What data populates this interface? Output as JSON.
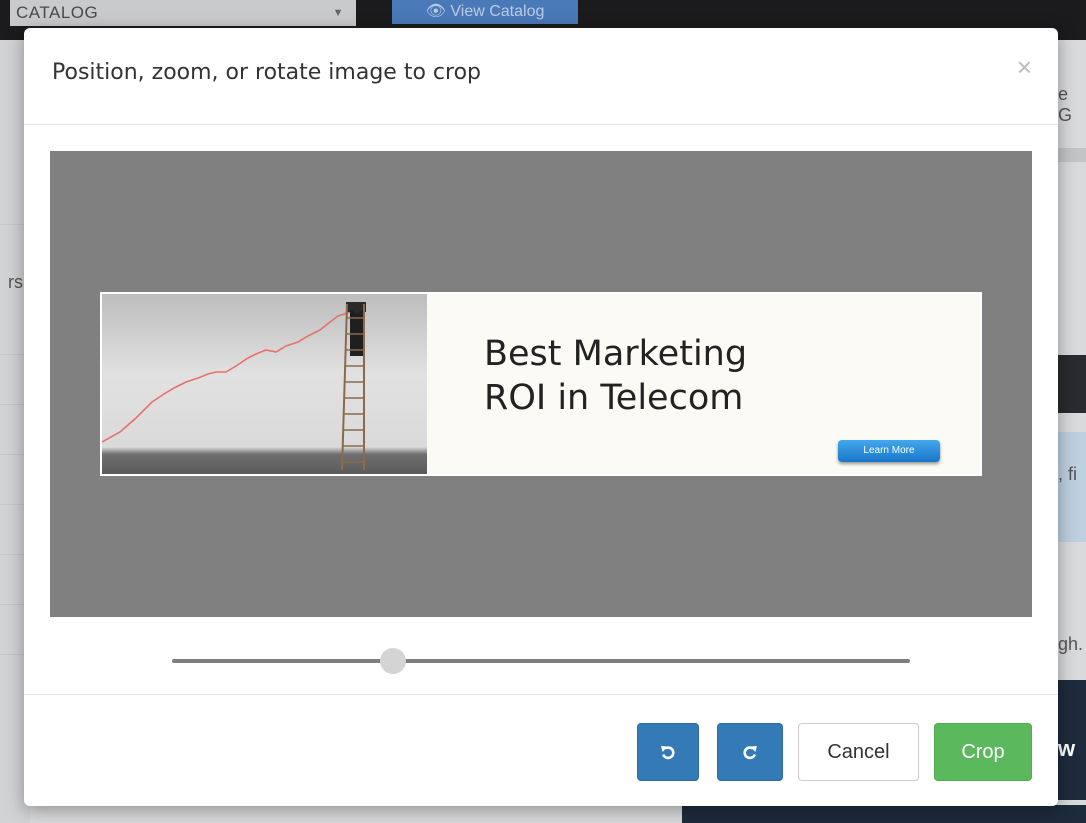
{
  "background": {
    "catalog_select_value": "CATALOG",
    "view_catalog_label": "View Catalog",
    "right_fragments": [
      "e G",
      ", fi",
      "gh.",
      "w"
    ],
    "left_fragment": "rs"
  },
  "modal": {
    "title": "Position, zoom, or rotate image to crop",
    "close_label": "×",
    "image": {
      "headline_line1": "Best Marketing",
      "headline_line2": "ROI in Telecom",
      "cta_label": "Learn More"
    },
    "zoom": {
      "value": 0.3
    },
    "buttons": {
      "rotate_left_icon": "rotate-left-icon",
      "rotate_right_icon": "rotate-right-icon",
      "cancel_label": "Cancel",
      "crop_label": "Crop"
    }
  }
}
